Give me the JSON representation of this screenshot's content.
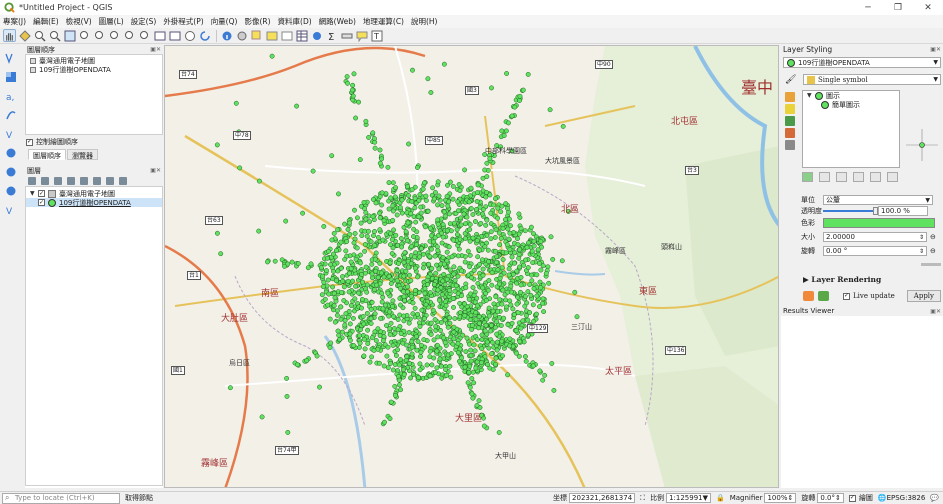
{
  "window": {
    "title": "*Untitled Project - QGIS",
    "buttons": [
      "─",
      "❐",
      "✕"
    ]
  },
  "menu": [
    "專案(J)",
    "編輯(E)",
    "檢視(V)",
    "圖層(L)",
    "設定(S)",
    "外掛程式(P)",
    "向量(Q)",
    "影像(R)",
    "資料庫(D)",
    "網路(Web)",
    "地理運算(C)",
    "說明(H)"
  ],
  "bookmarks": {
    "title": "圖層順序",
    "items": [
      "臺灣通用電子地圖",
      "109行道樹OPENDATA"
    ]
  },
  "control": {
    "checkbox_label": "控制繪圖順序",
    "checked": true
  },
  "tabs": [
    "圖層順序",
    "瀏覽器"
  ],
  "layers_panel": {
    "title": "圖層",
    "items": [
      {
        "label": "臺灣通用電子地圖",
        "checked": true
      },
      {
        "label": "109行道樹OPENDATA",
        "checked": true
      }
    ]
  },
  "map": {
    "district_labels": [
      "北區",
      "東區",
      "南區",
      "大肚區",
      "北屯區",
      "太平區",
      "大里區",
      "霧峰區"
    ],
    "big_label": "臺中",
    "place_labels": [
      "中部科學園區",
      "大坑風景區",
      "霧峰區",
      "烏日區",
      "三汀山",
      "頭嵙山",
      "大甲山"
    ],
    "road_labels": [
      "台74",
      "台1",
      "台63",
      "中78",
      "中85",
      "中90",
      "國1",
      "國3",
      "台3",
      "中129",
      "中136",
      "台74甲"
    ]
  },
  "styling": {
    "title": "Layer Styling",
    "layer": "109行道樹OPENDATA",
    "renderer": "Single symbol",
    "tree_root": "圖示",
    "tree_child": "簡單圖示",
    "unit_label": "單位",
    "unit_value": "公釐",
    "opacity_label": "透明度",
    "opacity_value": "100.0 %",
    "color_label": "色彩",
    "color_value": "#5fe25f",
    "size_label": "大小",
    "size_value": "2.00000",
    "rotation_label": "旋轉",
    "rotation_value": "0.00 °",
    "layer_rendering": "Layer Rendering",
    "live_update": "Live update",
    "live_checked": true,
    "apply": "Apply"
  },
  "results": {
    "title": "Results Viewer"
  },
  "status": {
    "locate_placeholder": "Type to locate (Ctrl+K)",
    "messages": "取得節點",
    "coord_label": "坐標",
    "coord_value": "202321,2681374",
    "scale_label": "比例",
    "scale_value": "1:125991",
    "magnifier_label": "Magnifier",
    "magnifier_value": "100%",
    "rotation_label": "旋轉",
    "rotation_value": "0.0°",
    "render_label": "繪圖",
    "crs": "EPSG:3826"
  }
}
